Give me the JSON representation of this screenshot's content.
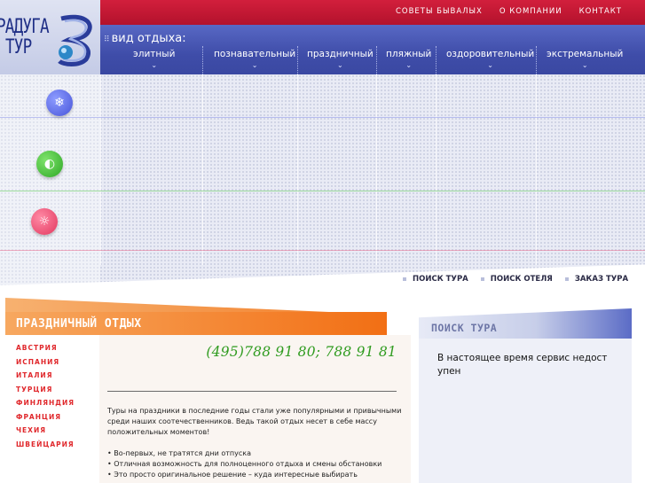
{
  "logo": {
    "line1": "РАДУГА",
    "line2": "ТУР"
  },
  "top_nav": {
    "items": [
      "СОВЕТЫ БЫВАЛЫХ",
      "О КОМПАНИИ",
      "КОНТАКТ"
    ]
  },
  "categories": {
    "heading": "вид отдыха:",
    "items": [
      "элитный",
      "познавательный",
      "праздничный",
      "пляжный",
      "оздоровительный",
      "экстремальный"
    ]
  },
  "season_buttons": {
    "winter_icon": "snowflake-icon",
    "summer_icon": "leaf-icon",
    "sun_icon": "sun-icon"
  },
  "search_tabs": [
    "ПОИСК ТУРА",
    "ПОИСК ОТЕЛЯ",
    "ЗАКАЗ ТУРА"
  ],
  "section": {
    "title": "ПРАЗДНИЧНЫЙ ОТДЫХ"
  },
  "countries": [
    "АВСТРИЯ",
    "ИСПАНИЯ",
    "ИТАЛИЯ",
    "ТУРЦИЯ",
    "ФИНЛЯНДИЯ",
    "ФРАНЦИЯ",
    "ЧЕХИЯ",
    "ШВЕЙЦАРИЯ"
  ],
  "content": {
    "phone": "(495)788 91 80; 788 91 81",
    "intro": "Туры на праздники в последние годы стали уже популярными и привычными среди наших соотечественников. Ведь такой отдых несет в себе массу положительных моментов!",
    "features": [
      "• Во-первых, не тратятся дни отпуска",
      "• Отличная возможность для полноценного отдыха и смены обстановки",
      "• Это просто оригинальное решение – куда интересные выбирать"
    ]
  },
  "search_panel": {
    "title": "ПОИСК ТУРА",
    "message": "В настоящее время сервис недоступен"
  },
  "colors": {
    "header_red": "#c41830",
    "category_blue": "#4250a8",
    "accent_orange": "#f37d25",
    "country_red": "#e0282c",
    "phone_green": "#2f9b1f"
  }
}
